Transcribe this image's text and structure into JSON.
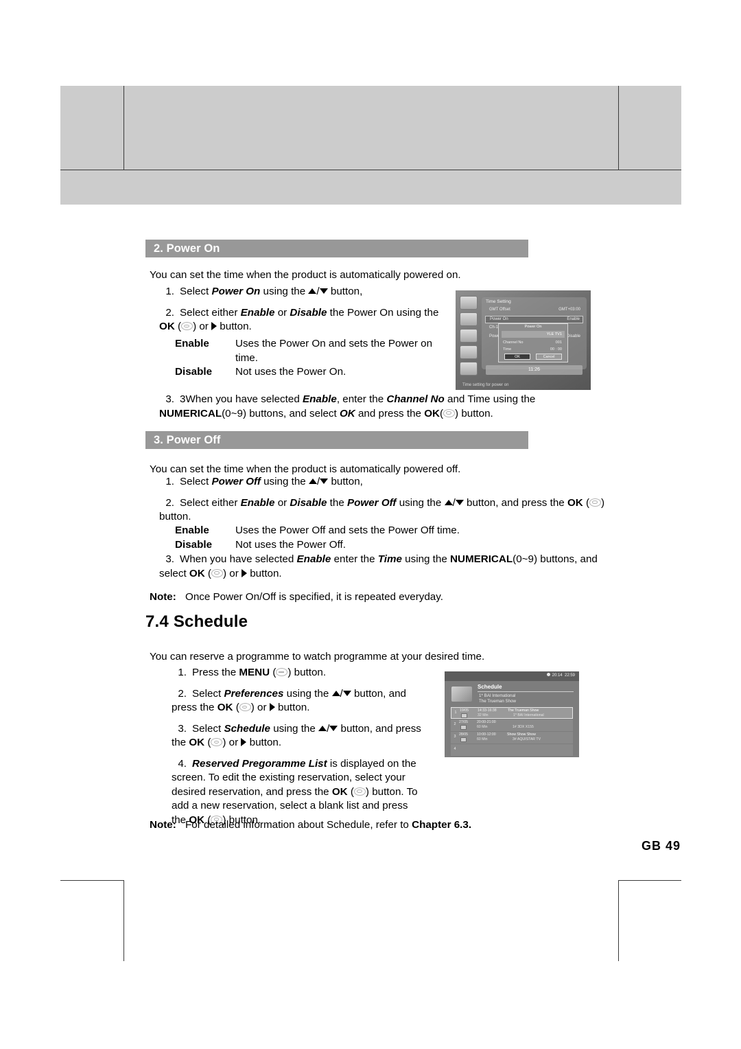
{
  "page": {
    "footer_label": "GB 49"
  },
  "sections": [
    {
      "bar_label": "2. Power On",
      "intro": "You can set the time when the product is automatically powered on.",
      "steps": [
        {
          "num": "1.",
          "pre": "Select ",
          "em1": "Power On",
          "mid": " using the ",
          "post": " button,"
        },
        {
          "num": "2.",
          "pre": "Select either ",
          "em1": "Enable",
          "mid": " or ",
          "em2": "Disable",
          "mid2": " the Power On using the",
          "line2_pre": "OK",
          "line2_post": ") or",
          "line2_end": " button."
        },
        {
          "num": "3.",
          "text_a": "3When you have selected ",
          "em_a": "Enable",
          "text_b": ", enter the ",
          "em_b": "Channel No",
          "text_c": " and Time using the",
          "text_d": "NUMERICAL",
          "text_e": "(0~9) buttons, and select ",
          "em_c": "OK",
          "text_f": " and press the ",
          "text_g": "OK",
          "text_h": ") button."
        }
      ],
      "definitions": [
        {
          "term": "Enable",
          "desc_line1": "Uses the Power On and sets the Power on",
          "desc_line2": "time."
        },
        {
          "term": "Disable",
          "desc_line1": "Not uses the Power On.",
          "desc_line2": ""
        }
      ]
    },
    {
      "bar_label": "3. Power Off",
      "intro": "You can set the time when the product is automatically powered off.",
      "steps": [
        {
          "num": "1.",
          "pre": "Select ",
          "em1": "Power Off",
          "mid": " using the ",
          "post": " button,"
        },
        {
          "num": "2.",
          "pre": "Select either ",
          "em1": "Enable",
          "mid": " or ",
          "em2": "Disable",
          "mid2": " the ",
          "em3": "Power Off",
          "mid3": " using the ",
          "tail": " button, and press the ",
          "ok": "OK",
          "line2": "button."
        },
        {
          "num": "3.",
          "text_a": "When you have selected ",
          "em_a": "Enable",
          "text_b": " enter the ",
          "em_b": "Time",
          "text_c": " using the ",
          "text_d": "NUMERICAL",
          "text_e": "(0~9) buttons, and",
          "line2_pre": "select ",
          "line2_ok": "OK",
          "line2_mid": ") or",
          "line2_end": " button."
        }
      ],
      "definitions": [
        {
          "term": "Enable",
          "desc_line1": "Uses the Power Off and sets the Power Off time.",
          "desc_line2": ""
        },
        {
          "term": "Disable",
          "desc_line1": "Not uses the Power Off.",
          "desc_line2": ""
        }
      ],
      "note": {
        "label": "Note:",
        "text": "Once Power On/Off is specified, it is repeated everyday."
      }
    }
  ],
  "chapter": {
    "title": "7.4 Schedule",
    "intro": "You can reserve a programme to watch programme at your desired time.",
    "steps": [
      {
        "num": "1.",
        "pre": "Press the ",
        "bold": "MENU",
        "post": ") button."
      },
      {
        "num": "2.",
        "pre": "Select ",
        "em1": "Preferences",
        "mid": " using the ",
        "tail": " button, and",
        "line2_pre": "press the ",
        "line2_ok": "OK",
        "line2_mid": ") or",
        "line2_end": " button."
      },
      {
        "num": "3.",
        "pre": "Select ",
        "em1": "Schedule",
        "mid": " using the ",
        "tail": " button, and press",
        "line2_pre": "the ",
        "line2_ok": "OK",
        "line2_mid": ") or",
        "line2_end": " button."
      },
      {
        "num": "4.",
        "em1": "Reserved Pregoramme List",
        "t1": " is displayed on the",
        "l2": "screen. To edit the existing reservation, select your",
        "l3_a": "desired reservation, and press the ",
        "l3_ok": "OK",
        "l3_b": ") button. To",
        "l4": "add a new reservation, select a blank list and press",
        "l5_a": "the ",
        "l5_ok": "OK",
        "l5_b": ") button."
      }
    ],
    "note": {
      "label": "Note:",
      "text_a": "For detailed information about Schedule, refer to ",
      "bold": "Chapter 6.3."
    }
  },
  "tv_time_setting": {
    "panel_title": "Time Setting",
    "rows": [
      {
        "label": "GMT Offset",
        "value": "GMT+03:00"
      },
      {
        "label": "Power On",
        "value": "Enable"
      },
      {
        "label": "Ch-1",
        "value": ""
      },
      {
        "label": "Power Off",
        "value": "Disable"
      }
    ],
    "dialog": {
      "title": "Power On",
      "field_value": "YLE TV1",
      "channel_label": "Channel No",
      "channel_value": "001",
      "time_label": "Time",
      "time_value": "00 : 00",
      "ok_label": "OK",
      "cancel_label": "Cancel"
    },
    "clock": "11:26",
    "help_text": "Time setting for power on"
  },
  "tv_schedule": {
    "title": "Schedule",
    "clock_current": "20:14",
    "clock_second": "22:59",
    "sub_channel": "1* BAI International",
    "sub_programme": "The Trueman Show",
    "rows": [
      {
        "idx": "1",
        "date": "19/05",
        "time": "14:33-16:38",
        "duration": "32 Min",
        "programme": "The Trueman Show",
        "channel": "1* BAI International",
        "selected": true
      },
      {
        "idx": "2",
        "date": "27/05",
        "time": "20:00-21:00",
        "duration": "60 Min",
        "programme": "",
        "channel": "1# 3DX X155",
        "selected": false
      },
      {
        "idx": "3",
        "date": "28/05",
        "time": "10:00-12:00",
        "duration": "60 Min",
        "programme": "Show Show Show",
        "channel": "3# AQUISTAR TV",
        "selected": false
      },
      {
        "idx": "4",
        "date": "",
        "time": "",
        "duration": "",
        "programme": "",
        "channel": "",
        "selected": false
      }
    ]
  }
}
